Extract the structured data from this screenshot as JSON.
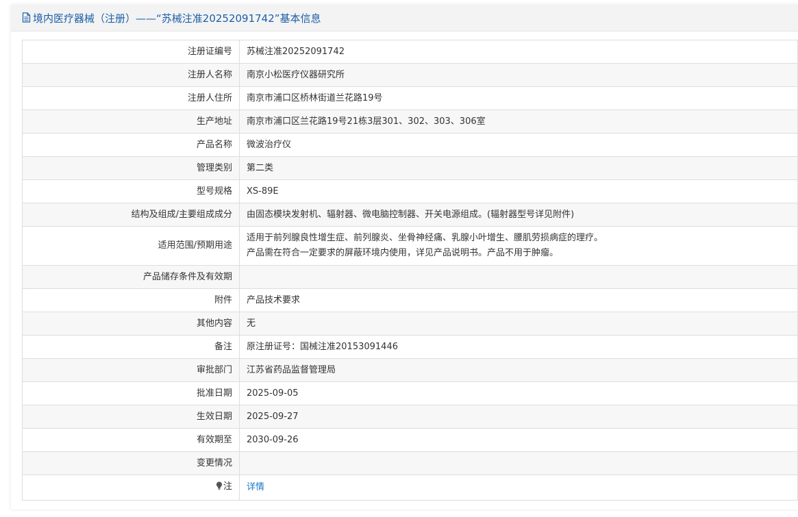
{
  "header": {
    "title": "境内医疗器械（注册）——“苏械注准20252091742”基本信息",
    "icon": "document-icon",
    "color": "#1a5fa8"
  },
  "rows": [
    {
      "label": "注册证编号",
      "value": "苏械注准20252091742"
    },
    {
      "label": "注册人名称",
      "value": "南京小松医疗仪器研究所"
    },
    {
      "label": "注册人住所",
      "value": "南京市浦口区桥林街道兰花路19号"
    },
    {
      "label": "生产地址",
      "value": "南京市浦口区兰花路19号21栋3层301、302、303、306室"
    },
    {
      "label": "产品名称",
      "value": "微波治疗仪"
    },
    {
      "label": "管理类别",
      "value": "第二类"
    },
    {
      "label": "型号规格",
      "value": "XS-89E"
    },
    {
      "label": "结构及组成/主要组成成分",
      "value": "由固态模块发射机、辐射器、微电脑控制器、开关电源组成。(辐射器型号详见附件)"
    },
    {
      "label": "适用范围/预期用途",
      "value_line1": "适用于前列腺良性增生症、前列腺炎、坐骨神经痛、乳腺小叶增生、腰肌劳损病症的理疗。",
      "value_line2": "产品需在符合一定要求的屏蔽环境内使用，详见产品说明书。产品不用于肿瘤。"
    },
    {
      "label": "产品储存条件及有效期",
      "value": ""
    },
    {
      "label": "附件",
      "value": "产品技术要求"
    },
    {
      "label": "其他内容",
      "value": "无"
    },
    {
      "label": "备注",
      "value": "原注册证号：国械注准20153091446"
    },
    {
      "label": "审批部门",
      "value": "江苏省药品监督管理局"
    },
    {
      "label": "批准日期",
      "value": "2025-09-05"
    },
    {
      "label": "生效日期",
      "value": "2025-09-27"
    },
    {
      "label": "有效期至",
      "value": "2030-09-26"
    },
    {
      "label": "变更情况",
      "value": ""
    },
    {
      "label": "注",
      "icon": "lightbulb-icon",
      "link": "详情"
    }
  ]
}
